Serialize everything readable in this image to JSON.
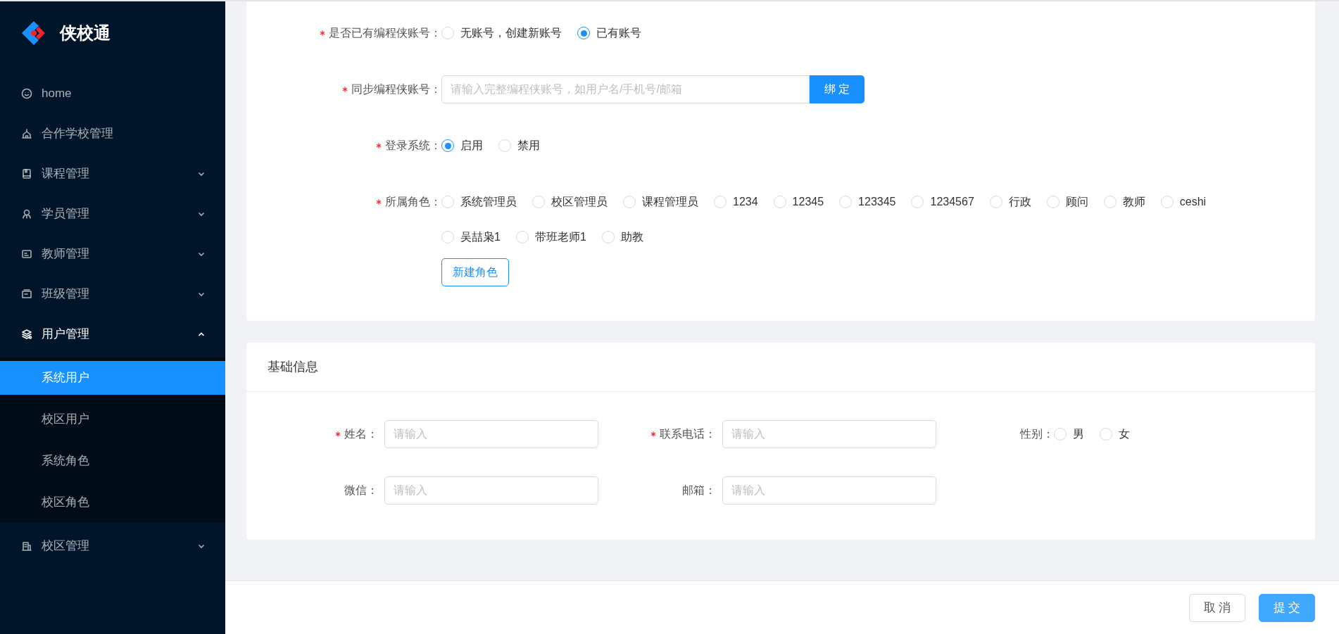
{
  "sidebar": {
    "brand": "侠校通",
    "items": [
      {
        "label": "home",
        "selected": false
      },
      {
        "label": "合作学校管理",
        "selected": false
      },
      {
        "label": "课程管理",
        "selected": false,
        "expanded": false
      },
      {
        "label": "学员管理",
        "selected": false,
        "expanded": false
      },
      {
        "label": "教师管理",
        "selected": false,
        "expanded": false
      },
      {
        "label": "班级管理",
        "selected": false,
        "expanded": false
      },
      {
        "label": "用户管理",
        "selected": false,
        "expanded": true,
        "children": [
          {
            "label": "系统用户",
            "selected": true
          },
          {
            "label": "校区用户",
            "selected": false
          },
          {
            "label": "系统角色",
            "selected": false
          },
          {
            "label": "校区角色",
            "selected": false
          }
        ]
      },
      {
        "label": "校区管理",
        "selected": false,
        "expanded": false
      }
    ]
  },
  "account_section": {
    "fields": [
      {
        "kind": "radio",
        "label": "是否已有编程侠账号：",
        "required": true,
        "options": [
          {
            "label": "无账号，创建新账号",
            "selected": false
          },
          {
            "label": "已有账号",
            "selected": true
          }
        ]
      },
      {
        "kind": "input_button",
        "label": "同步编程侠账号：",
        "required": true,
        "placeholder": "请输入完整编程侠账号，如用户名/手机号/邮箱",
        "button": "绑 定"
      },
      {
        "kind": "radio",
        "label": "登录系统：",
        "required": true,
        "options": [
          {
            "label": "启用",
            "selected": true
          },
          {
            "label": "禁用",
            "selected": false
          }
        ]
      },
      {
        "kind": "roles",
        "label": "所属角色：",
        "required": true,
        "options": [
          {
            "label": "系统管理员",
            "selected": false
          },
          {
            "label": "校区管理员",
            "selected": false
          },
          {
            "label": "课程管理员",
            "selected": false
          },
          {
            "label": "1234",
            "selected": false
          },
          {
            "label": "12345",
            "selected": false
          },
          {
            "label": "123345",
            "selected": false
          },
          {
            "label": "1234567",
            "selected": false
          },
          {
            "label": "行政",
            "selected": false
          },
          {
            "label": "顾问",
            "selected": false
          },
          {
            "label": "教师",
            "selected": false
          },
          {
            "label": "ceshi",
            "selected": false
          },
          {
            "label": "吴喆枭1",
            "selected": false
          },
          {
            "label": "带班老师1",
            "selected": false
          },
          {
            "label": "助教",
            "selected": false
          }
        ],
        "button": "新建角色"
      }
    ]
  },
  "basic_section": {
    "title": "基础信息",
    "fields": [
      {
        "kind": "input",
        "label": "姓名：",
        "required": true,
        "placeholder": "请输入"
      },
      {
        "kind": "input",
        "label": "联系电话：",
        "required": true,
        "placeholder": "请输入"
      },
      {
        "kind": "radio",
        "label": "性别：",
        "required": false,
        "options": [
          {
            "label": "男",
            "selected": false
          },
          {
            "label": "女",
            "selected": false
          }
        ]
      },
      {
        "kind": "input",
        "label": "微信：",
        "required": false,
        "placeholder": "请输入"
      },
      {
        "kind": "input",
        "label": "邮箱：",
        "required": false,
        "placeholder": "请输入"
      }
    ]
  },
  "footer": {
    "buttons": [
      {
        "label": "取 消",
        "kind": "default"
      },
      {
        "label": "提 交",
        "kind": "primary"
      }
    ]
  }
}
